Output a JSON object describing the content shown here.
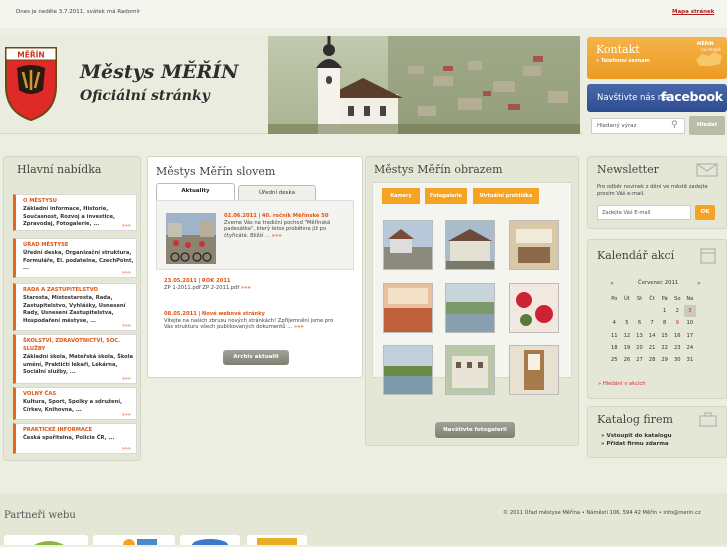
{
  "topbar": {
    "date": "Dnes je neděle 3.7.2011, svátek má Radomír",
    "sitemap": "Mapa stránek"
  },
  "header": {
    "title": "Městys MĚŘÍN",
    "subtitle": "Oficiální stránky",
    "crest_label": "MĚŘÍN"
  },
  "contact": {
    "title": "Kontakt",
    "link": "» Telefonní seznam",
    "map_label_1": "MĚŘÍN",
    "map_label_2": "na mapě"
  },
  "facebook": {
    "prefix": "Navštivte nás na",
    "brand": "facebook"
  },
  "search": {
    "placeholder": "Hledaný výraz",
    "button": "Hledat",
    "icon": "magnifier-icon"
  },
  "main_menu": {
    "title": "Hlavní nabídka",
    "items": [
      {
        "label": "O MĚSTYSU",
        "desc": "Základní informace, Historie, Současnost, Rozvoj a investice, Zpravodaj, Fotogalerie, ..."
      },
      {
        "label": "ÚŘAD MĚSTYSE",
        "desc": "Úřední deska, Organizační struktura, Formuláře, El. podatelna, CzechPoint, ..."
      },
      {
        "label": "RADA A ZASTUPITELSTVO",
        "desc": "Starosta, Místostarosta, Rada, Zastupitelstvo, Vyhlášky, Usnesení Rady, Usnesení Zastupitelstva, Hospodaření městyse, ..."
      },
      {
        "label": "ŠKOLSTVÍ, ZDRAVOTNICTVÍ, SOC. SLUŽBY",
        "desc": "Základní škola, Mateřská škola, Škola umění, Praktičtí lékaři, Lékárna, Sociální služby, ..."
      },
      {
        "label": "VOLNÝ ČAS",
        "desc": "Kultura, Sport, Spolky a sdružení, Církev, Knihovna, ..."
      },
      {
        "label": "PRAKTICKÉ INFORMACE",
        "desc": "Česká spořitelna, Policie ČR, ..."
      }
    ],
    "more": "»»»"
  },
  "news": {
    "title": "Městys Měřín slovem",
    "tab_active": "Aktuality",
    "tab_other": "Úřední deska",
    "items": [
      {
        "date": "02.06.2011",
        "sep": " | ",
        "title": "40. ročník Měřínské 50",
        "text": "Zveme Vás na tradiční pochod \"Měřínská padesátka\", který letos proběhne již po čtyřicáté. Bližší ...",
        "more": "»»»"
      },
      {
        "date": "23.05.2011",
        "sep": " | ",
        "title": "ROK 2011",
        "text": "ZP 1-2011.pdf ZP 2-2011.pdf",
        "more": "»»»"
      },
      {
        "date": "08.05.2011",
        "sep": " | ",
        "title": "Nové webové stránky",
        "text": "Vítejte na našich zbrusu nových stránkách! Zpříjemnění jsme pro Vás strukturu všech publikovaných dokumentů ...",
        "more": "»»»"
      }
    ],
    "archive_button": "Archiv aktualit"
  },
  "gallery": {
    "title": "Městys Měřín obrazem",
    "tabs": [
      "Kamery",
      "Fotogalerie",
      "Virtuální prohlídka"
    ],
    "button": "Navštivte fotogalerii"
  },
  "newsletter": {
    "title": "Newsletter",
    "text": "Pro odběr novinek z dění ve městě zadejte prosím Váš e-mail.",
    "placeholder": "Zadejte Váš E-mail",
    "button": "OK",
    "icon": "envelope-icon"
  },
  "calendar": {
    "title": "Kalendář akcí",
    "month": "Červenec 2011",
    "prev": "«",
    "next": "»",
    "days": [
      "Po",
      "Út",
      "St",
      "Čt",
      "Pá",
      "So",
      "Ne"
    ],
    "weeks": [
      [
        "",
        "",
        "",
        "",
        "1",
        "2",
        "3"
      ],
      [
        "4",
        "5",
        "6",
        "7",
        "8",
        "9",
        "10"
      ],
      [
        "11",
        "12",
        "13",
        "14",
        "15",
        "16",
        "17"
      ],
      [
        "18",
        "19",
        "20",
        "21",
        "22",
        "23",
        "24"
      ],
      [
        "25",
        "26",
        "27",
        "28",
        "29",
        "30",
        "31"
      ]
    ],
    "search_link": "» Hledání v akcích",
    "today": "3"
  },
  "companies": {
    "title": "Katalog firem",
    "links": [
      "» Vstoupit do katalogu",
      "» Přidat firmu zdarma"
    ]
  },
  "footer": {
    "partners": "Partneři webu",
    "copyright": "© 2011 Úřad městyse Měřína • Náměstí 106, 594 42 Měřín • info@merin.cz"
  },
  "colors": {
    "accent": "#e05410",
    "orange": "#f5a322",
    "facebook": "#3b5998",
    "panel": "#e4e7d6"
  }
}
